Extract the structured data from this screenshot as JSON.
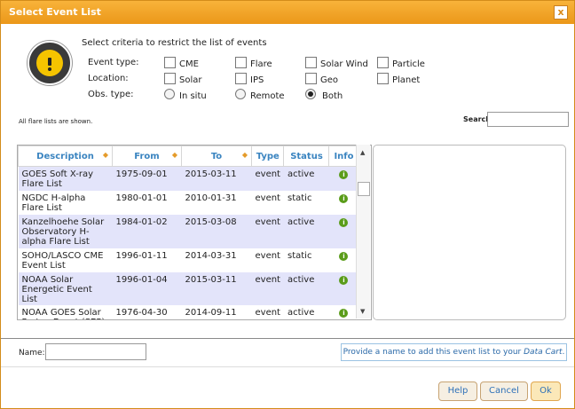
{
  "dialog": {
    "title": "Select Event List",
    "close_glyph": "x",
    "instruction": "Select criteria to restrict the list of events",
    "logo_icon": "warning-sun-icon"
  },
  "criteria": {
    "event_type_label": "Event type:",
    "location_label": "Location:",
    "obs_type_label": "Obs. type:",
    "event_types": [
      {
        "label": "CME",
        "checked": false
      },
      {
        "label": "Flare",
        "checked": false
      },
      {
        "label": "Solar Wind",
        "checked": false
      },
      {
        "label": "Particle",
        "checked": false
      }
    ],
    "locations": [
      {
        "label": "Solar",
        "checked": false
      },
      {
        "label": "IPS",
        "checked": false
      },
      {
        "label": "Geo",
        "checked": false
      },
      {
        "label": "Planet",
        "checked": false
      }
    ],
    "obs_types": [
      {
        "label": "In situ",
        "selected": false
      },
      {
        "label": "Remote",
        "selected": false
      },
      {
        "label": "Both",
        "selected": true
      }
    ]
  },
  "status_text": "All flare lists are shown.",
  "search": {
    "label": "Search",
    "value": ""
  },
  "table": {
    "columns": [
      "Description",
      "From",
      "To",
      "Type",
      "Status",
      "Info"
    ],
    "rows": [
      {
        "description": "GOES Soft X-ray Flare List",
        "from": "1975-09-01",
        "to": "2015-03-11",
        "type": "event",
        "status": "active",
        "info": "i"
      },
      {
        "description": "NGDC H-alpha Flare List",
        "from": "1980-01-01",
        "to": "2010-01-31",
        "type": "event",
        "status": "static",
        "info": "i"
      },
      {
        "description": "Kanzelhoehe Solar Observatory H-alpha Flare List",
        "from": "1984-01-02",
        "to": "2015-03-08",
        "type": "event",
        "status": "active",
        "info": "i"
      },
      {
        "description": "SOHO/LASCO CME Event List",
        "from": "1996-01-11",
        "to": "2014-03-31",
        "type": "event",
        "status": "static",
        "info": "i"
      },
      {
        "description": "NOAA Solar Energetic Event List",
        "from": "1996-01-04",
        "to": "2015-03-11",
        "type": "event",
        "status": "active",
        "info": "i"
      },
      {
        "description": "NOAA GOES Solar Proton Event (SEP)",
        "from": "1976-04-30",
        "to": "2014-09-11",
        "type": "event",
        "status": "active",
        "info": "i"
      }
    ]
  },
  "name": {
    "label": "Name:",
    "value": ""
  },
  "hint": {
    "prefix": "Provide a name to add this event list to your ",
    "link": "Data Cart",
    "suffix": "."
  },
  "buttons": {
    "help": "Help",
    "cancel": "Cancel",
    "ok": "Ok"
  }
}
